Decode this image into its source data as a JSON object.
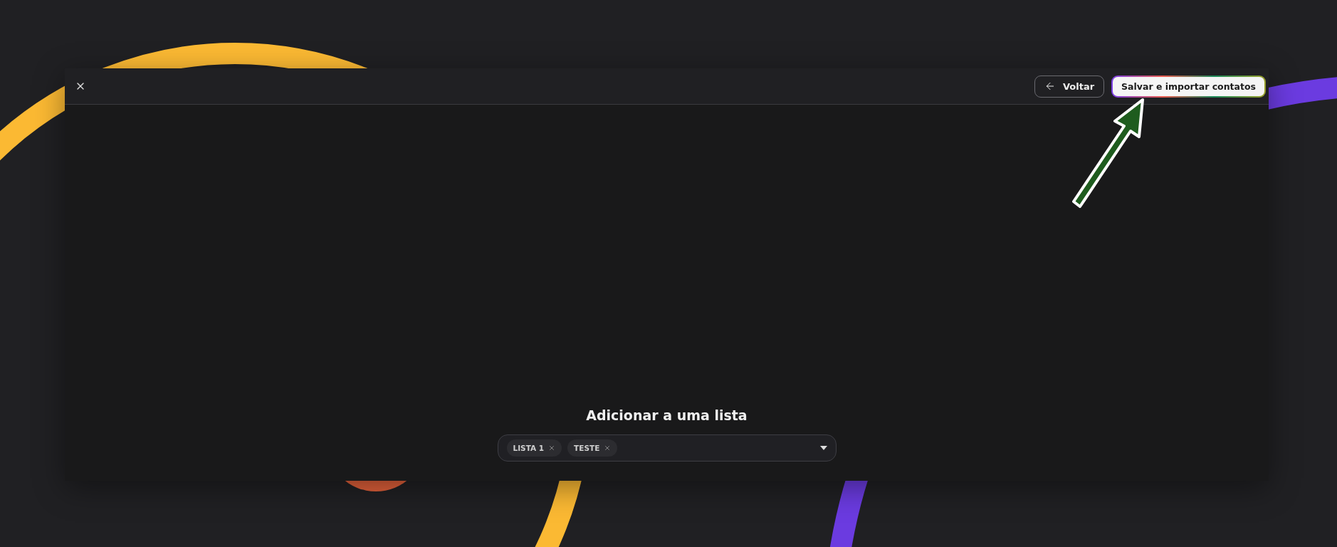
{
  "dialog": {
    "back_button": "Voltar",
    "save_button": "Salvar e importar contatos",
    "heading": "Adicionar a uma lista",
    "list_select": {
      "tags": [
        {
          "label": "LISTA 1"
        },
        {
          "label": "TESTE"
        }
      ]
    }
  }
}
